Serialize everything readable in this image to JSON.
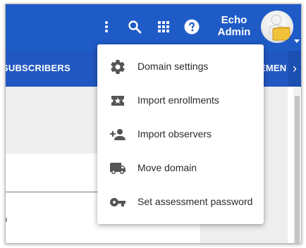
{
  "header": {
    "user_name": "Echo Admin",
    "user_first": "Echo",
    "user_last": "Admin",
    "icons": [
      "more-vert-icon",
      "search-icon",
      "apps-grid-icon",
      "help-icon"
    ]
  },
  "nav": {
    "tab_left": "SUBSCRIBERS",
    "tab_right": "EMEN",
    "next_arrow": "›"
  },
  "menu": {
    "items": [
      {
        "label": "Domain settings",
        "icon": "gear-icon"
      },
      {
        "label": "Import enrollments",
        "icon": "ticket-star-icon"
      },
      {
        "label": "Import observers",
        "icon": "person-add-icon"
      },
      {
        "label": "Move domain",
        "icon": "truck-icon"
      },
      {
        "label": "Set assessment password",
        "icon": "key-icon"
      }
    ]
  },
  "colors": {
    "header_bg": "#1f5bc6",
    "nav_bg": "#2157c0",
    "menu_icon": "#555555"
  }
}
